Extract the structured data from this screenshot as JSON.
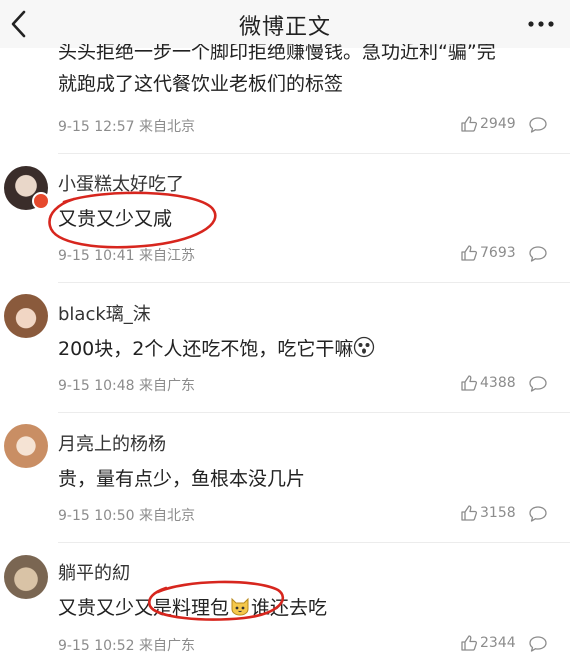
{
  "header": {
    "title": "微博正文",
    "back_icon": "chevron-left-icon",
    "more_icon": "more-dots-icon"
  },
  "previous_comment": {
    "text_line1": "头头拒绝一步一个脚印拒绝赚慢钱。急功近利“骗”完",
    "text_line2": "就跑成了这代餐饮业老板们的标签",
    "meta": "9-15 12:57 来自北京",
    "likes": "2949"
  },
  "comments": [
    {
      "username": "小蛋糕太好吃了",
      "text": "又贵又少又咸",
      "meta": "9-15 10:41 来自江苏",
      "likes": "7693"
    },
    {
      "username": "black璃_沫",
      "text": "200块，2个人还吃不饱，吃它干嘛",
      "meta": "9-15 10:48 来自广东",
      "likes": "4388"
    },
    {
      "username": "月亮上的杨杨",
      "text": "贵，量有点少，鱼根本没几片",
      "meta": "9-15 10:50 来自北京",
      "likes": "3158"
    },
    {
      "username": "躺平的糿",
      "text_before": "又贵又少又是料理包",
      "text_after": "谁还去吃",
      "meta": "9-15 10:52 来自广东",
      "likes": "2344"
    }
  ],
  "colors": {
    "annotation_red": "#d7261e",
    "meta_gray": "#8c8c8c",
    "badge_red": "#e6492d"
  }
}
